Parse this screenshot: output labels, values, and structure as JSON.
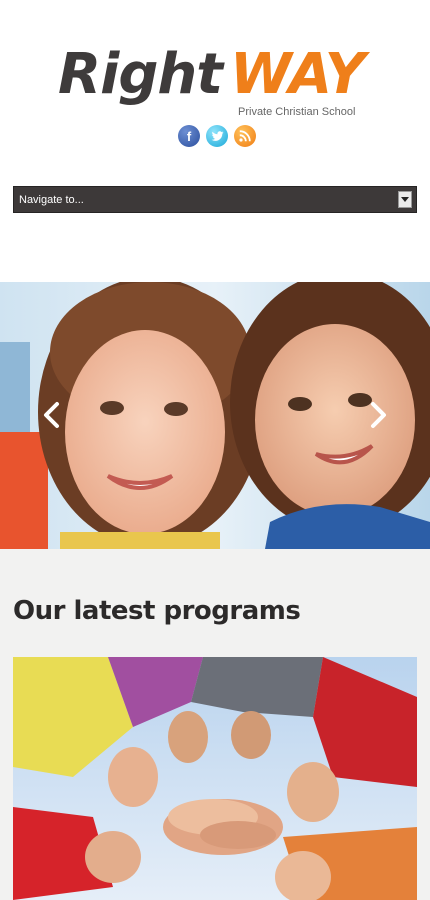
{
  "logo": {
    "word1": "Right",
    "word2": "WAY",
    "tagline": "Private Christian School",
    "colors": {
      "dark": "#3e3b3b",
      "accent": "#ef7f1a"
    }
  },
  "social": [
    {
      "icon": "facebook-icon",
      "glyph": "f"
    },
    {
      "icon": "twitter-icon",
      "glyph": "t"
    },
    {
      "icon": "rss-icon",
      "glyph": ""
    }
  ],
  "nav": {
    "selected": "Navigate to...",
    "icon": "chevron-down-icon"
  },
  "slider": {
    "prev_icon": "chevron-left-icon",
    "next_icon": "chevron-right-icon"
  },
  "programs": {
    "title": "Our latest programs"
  }
}
